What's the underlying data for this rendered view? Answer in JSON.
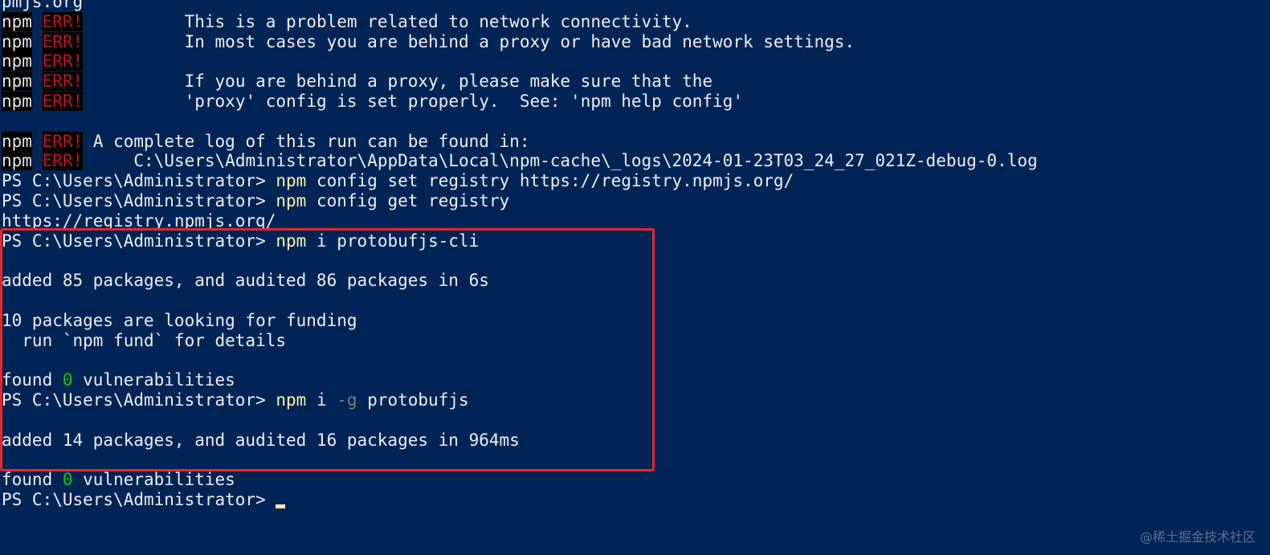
{
  "terminal": {
    "lines": [
      {
        "type": "plain",
        "text": "pmjs.org"
      },
      {
        "type": "npm-err",
        "prefix": "npm",
        "err": "ERR!",
        "text": "          This is a problem related to network connectivity."
      },
      {
        "type": "npm-err",
        "prefix": "npm",
        "err": "ERR!",
        "text": "          In most cases you are behind a proxy or have bad network settings."
      },
      {
        "type": "npm-err",
        "prefix": "npm",
        "err": "ERR!",
        "text": ""
      },
      {
        "type": "npm-err",
        "prefix": "npm",
        "err": "ERR!",
        "text": "          If you are behind a proxy, please make sure that the"
      },
      {
        "type": "npm-err",
        "prefix": "npm",
        "err": "ERR!",
        "text": "          'proxy' config is set properly.  See: 'npm help config'"
      },
      {
        "type": "blank",
        "text": ""
      },
      {
        "type": "npm-err",
        "prefix": "npm",
        "err": "ERR!",
        "text": " A complete log of this run can be found in:"
      },
      {
        "type": "npm-err",
        "prefix": "npm",
        "err": "ERR!",
        "text": "     C:\\Users\\Administrator\\AppData\\Local\\npm-cache\\_logs\\2024-01-23T03_24_27_021Z-debug-0.log"
      },
      {
        "type": "prompt",
        "prompt": "PS C:\\Users\\Administrator> ",
        "cmd": "npm",
        "args": " config set registry https://registry.npmjs.org/"
      },
      {
        "type": "prompt",
        "prompt": "PS C:\\Users\\Administrator> ",
        "cmd": "npm",
        "args": " config get registry"
      },
      {
        "type": "plain",
        "text": "https://registry.npmjs.org/"
      },
      {
        "type": "prompt",
        "prompt": "PS C:\\Users\\Administrator> ",
        "cmd": "npm",
        "args": " i protobufjs-cli"
      },
      {
        "type": "blank",
        "text": ""
      },
      {
        "type": "plain",
        "text": "added 85 packages, and audited 86 packages in 6s"
      },
      {
        "type": "blank",
        "text": ""
      },
      {
        "type": "plain",
        "text": "10 packages are looking for funding"
      },
      {
        "type": "plain",
        "text": "  run `npm fund` for details"
      },
      {
        "type": "blank",
        "text": ""
      },
      {
        "type": "found",
        "pre": "found ",
        "count": "0",
        "post": " vulnerabilities"
      },
      {
        "type": "prompt-flag",
        "prompt": "PS C:\\Users\\Administrator> ",
        "cmd": "npm",
        "mid": " i ",
        "flag": "-g",
        "args": " protobufjs"
      },
      {
        "type": "blank",
        "text": ""
      },
      {
        "type": "plain",
        "text": "added 14 packages, and audited 16 packages in 964ms"
      },
      {
        "type": "blank",
        "text": ""
      },
      {
        "type": "found",
        "pre": "found ",
        "count": "0",
        "post": " vulnerabilities"
      },
      {
        "type": "cursor",
        "prompt": "PS C:\\Users\\Administrator> "
      }
    ]
  },
  "watermark": "@稀土掘金技术社区",
  "colors": {
    "background": "#012456",
    "text": "#eeedf0",
    "err": "#c0161c",
    "command": "#f9f1a5",
    "number": "#16c60c",
    "muted": "#7a7a7a",
    "highlight_border": "#e8262a"
  }
}
